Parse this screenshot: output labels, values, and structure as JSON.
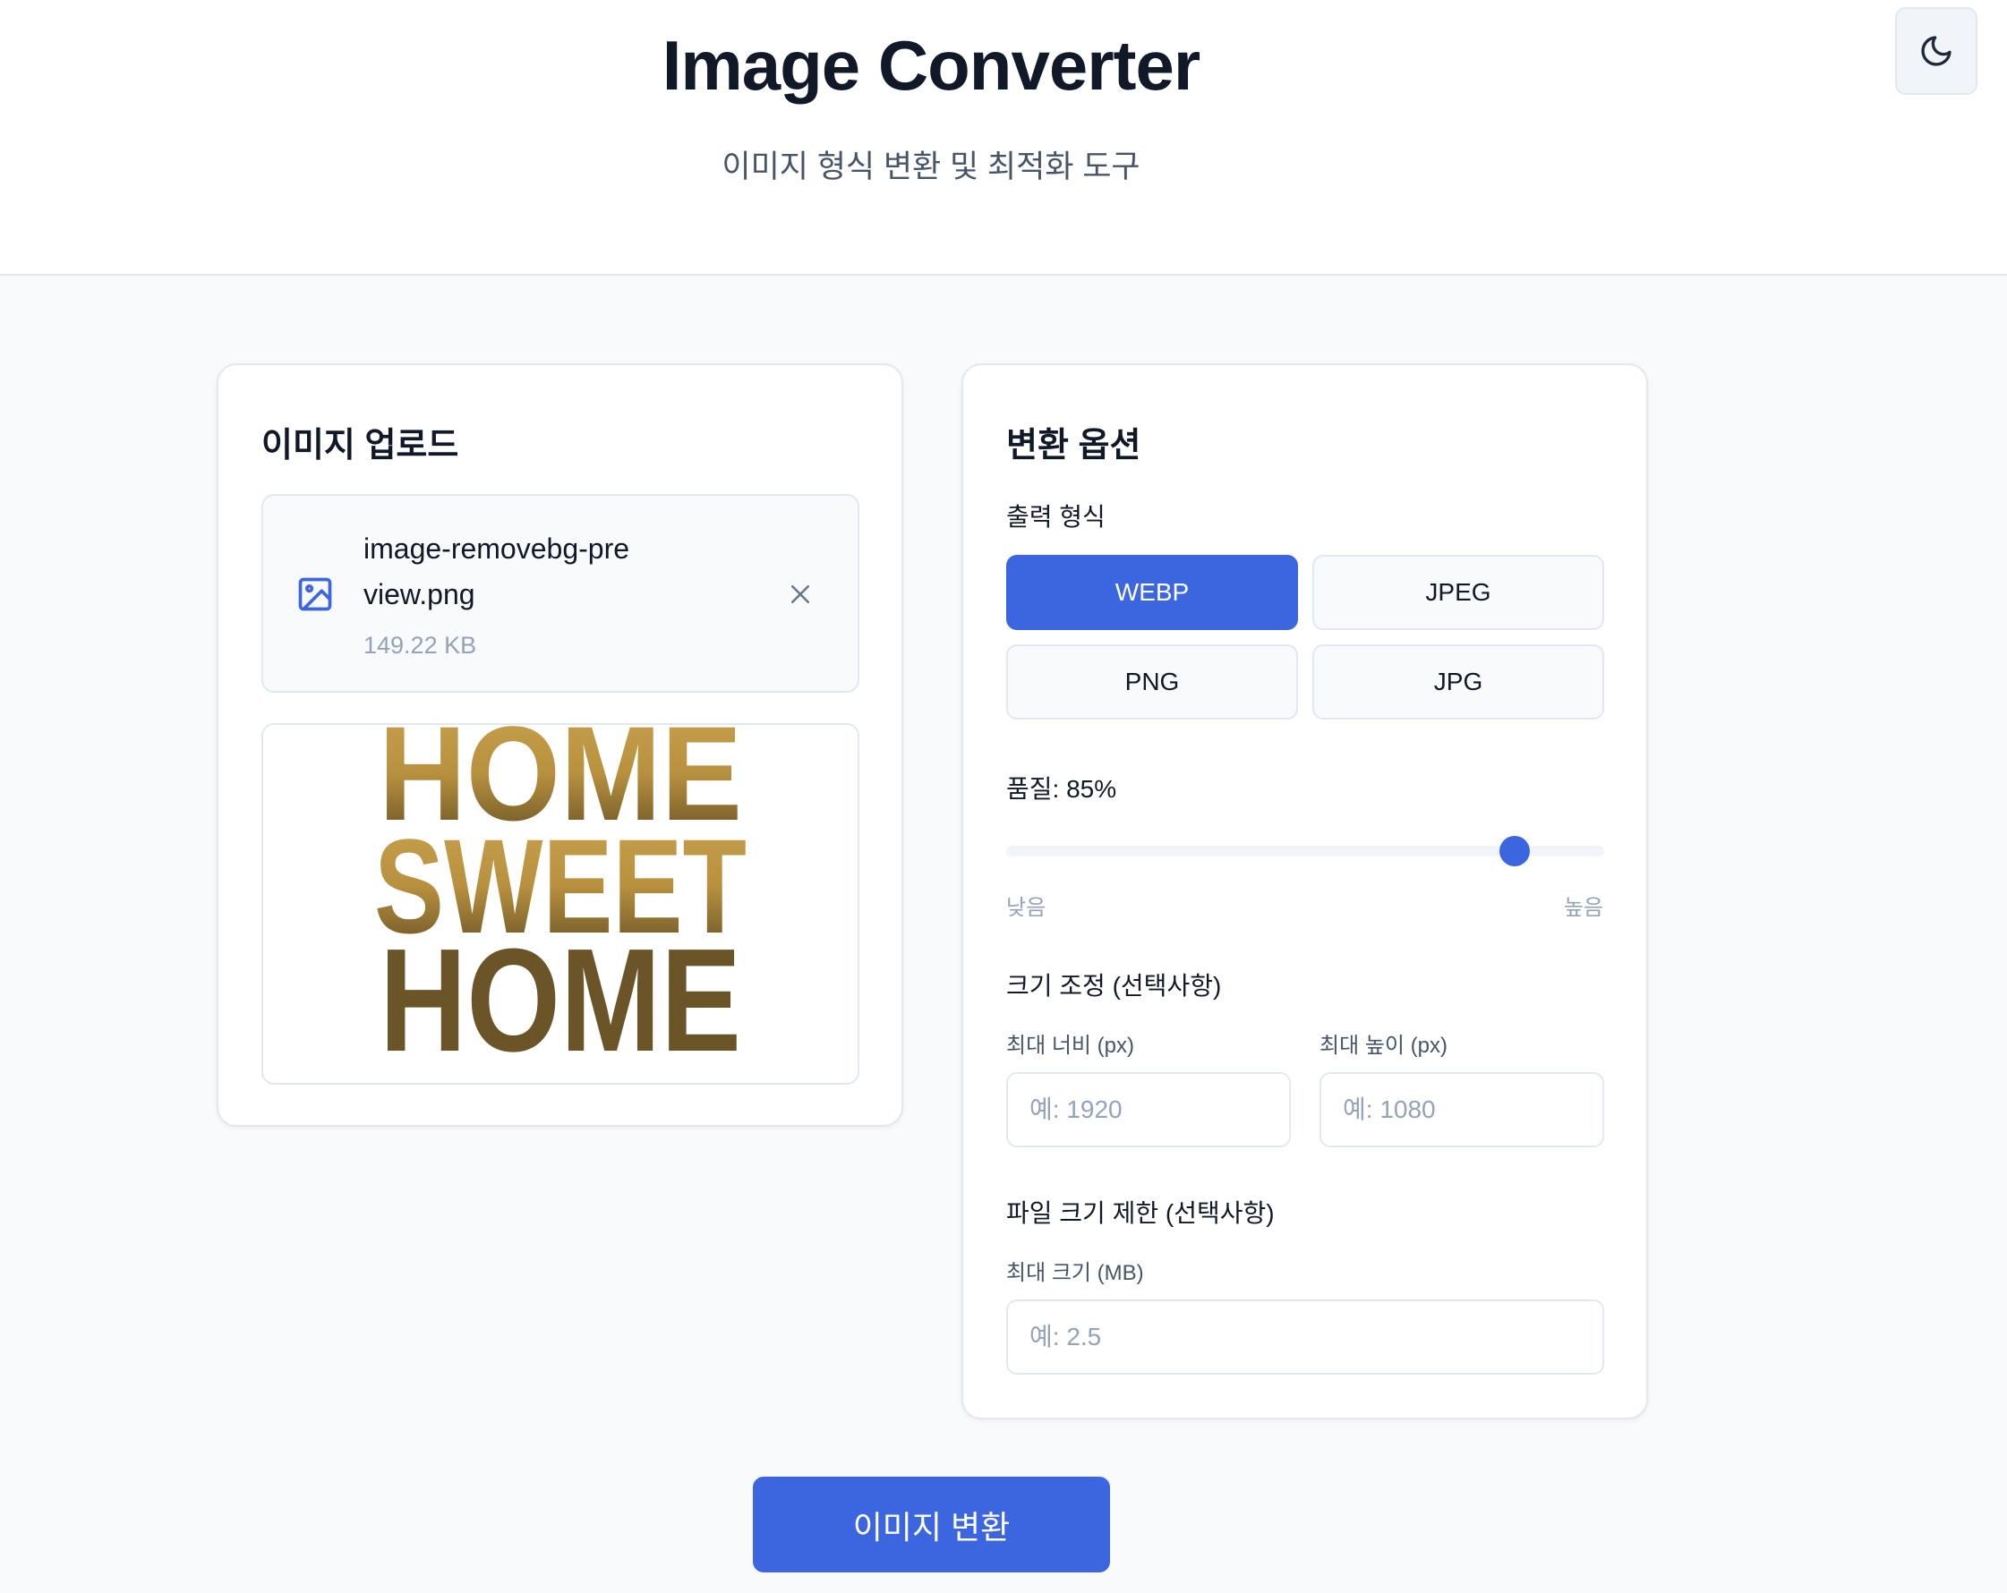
{
  "header": {
    "title": "Image Converter",
    "subtitle": "이미지 형식 변환 및 최적화 도구",
    "theme_icon": "moon-icon"
  },
  "upload": {
    "title": "이미지 업로드",
    "file_name": "image-removebg-preview.png",
    "file_size": "149.22 KB",
    "file_icon": "image-icon",
    "remove_icon": "close-icon",
    "preview_lines": [
      "HOME",
      "SWEET",
      "HOME"
    ]
  },
  "options": {
    "title": "변환 옵션",
    "format_label": "출력 형식",
    "formats": [
      "WEBP",
      "JPEG",
      "PNG",
      "JPG"
    ],
    "selected_format": "WEBP",
    "quality_label": "품질: 85%",
    "quality_value": 85,
    "quality_low": "낮음",
    "quality_high": "높음",
    "resize_label": "크기 조정 (선택사항)",
    "max_width_label": "최대 너비 (px)",
    "max_width_placeholder": "예: 1920",
    "max_height_label": "최대 높이 (px)",
    "max_height_placeholder": "예: 1080",
    "filesize_label": "파일 크기 제한 (선택사항)",
    "max_size_label": "최대 크기 (MB)",
    "max_size_placeholder": "예: 2.5"
  },
  "actions": {
    "convert_label": "이미지 변환"
  },
  "colors": {
    "accent": "#3b66e0",
    "background": "#f8fafc",
    "border": "#e2e8f0",
    "preview_gold": "#c19a4a",
    "preview_brown": "#6b5427"
  }
}
